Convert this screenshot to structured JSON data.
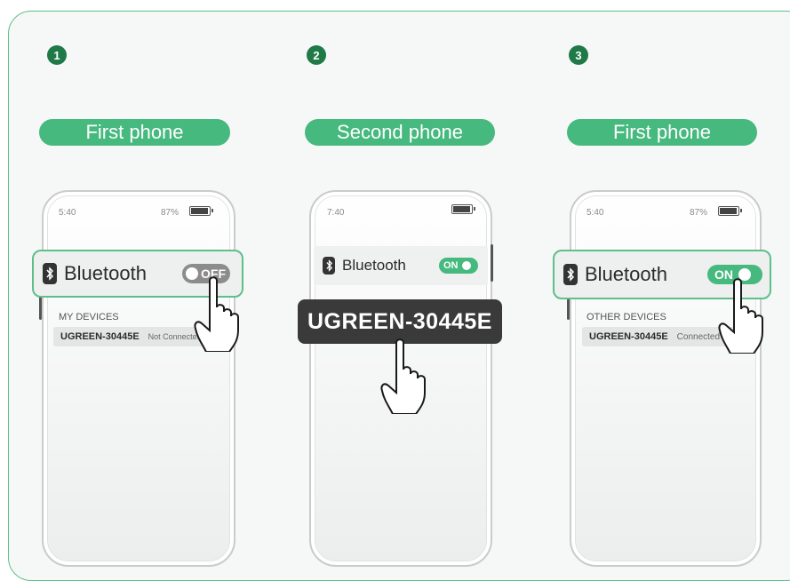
{
  "steps": [
    {
      "number": "1",
      "label": "First phone",
      "time": "5:40",
      "battery": "87%",
      "bluetooth_label": "Bluetooth",
      "toggle": "OFF",
      "section": "MY DEVICES",
      "device_name": "UGREEN-30445E",
      "device_status": "Not Connected"
    },
    {
      "number": "2",
      "label": "Second phone",
      "time": "7:40",
      "bluetooth_label": "Bluetooth",
      "toggle": "ON",
      "popup_device": "UGREEN-30445E"
    },
    {
      "number": "3",
      "label": "First phone",
      "time": "5:40",
      "battery": "87%",
      "bluetooth_label": "Bluetooth",
      "toggle": "ON",
      "section": "OTHER DEVICES",
      "device_name": "UGREEN-30445E",
      "device_status": "Connected"
    }
  ],
  "colors": {
    "accent": "#46b97f",
    "step_badge": "#1f7a48",
    "highlight_border": "#5fbe8c",
    "popup_bg": "#3a3a3a",
    "toggle_off": "#8c8c8c"
  },
  "icons": [
    "bluetooth-icon",
    "hand-pointer-icon",
    "battery-icon"
  ]
}
